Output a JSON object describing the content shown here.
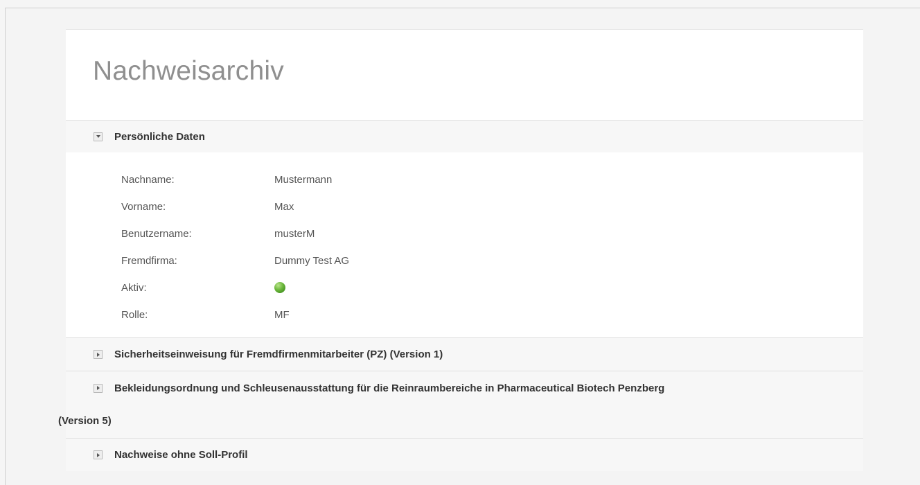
{
  "page": {
    "title": "Nachweisarchiv"
  },
  "personal": {
    "header": "Persönliche Daten",
    "rows": [
      {
        "label": "Nachname:",
        "value": "Mustermann"
      },
      {
        "label": "Vorname:",
        "value": "Max"
      },
      {
        "label": "Benutzername:",
        "value": "musterM"
      },
      {
        "label": "Fremdfirma:",
        "value": "Dummy Test AG"
      },
      {
        "label": "Aktiv:",
        "value": "",
        "status": "active",
        "status_color": "#4caf2a"
      },
      {
        "label": "Rolle:",
        "value": "MF"
      }
    ]
  },
  "sections": [
    {
      "label": "Sicherheitseinweisung für Fremdfirmenmitarbeiter (PZ) (Version 1)"
    },
    {
      "label_line1": "Bekleidungsordnung und Schleusenausstattung für die Reinraumbereiche in Pharmaceutical Biotech Penzberg",
      "label_line2": "(Version 5)"
    },
    {
      "label": "Nachweise ohne Soll-Profil"
    }
  ]
}
